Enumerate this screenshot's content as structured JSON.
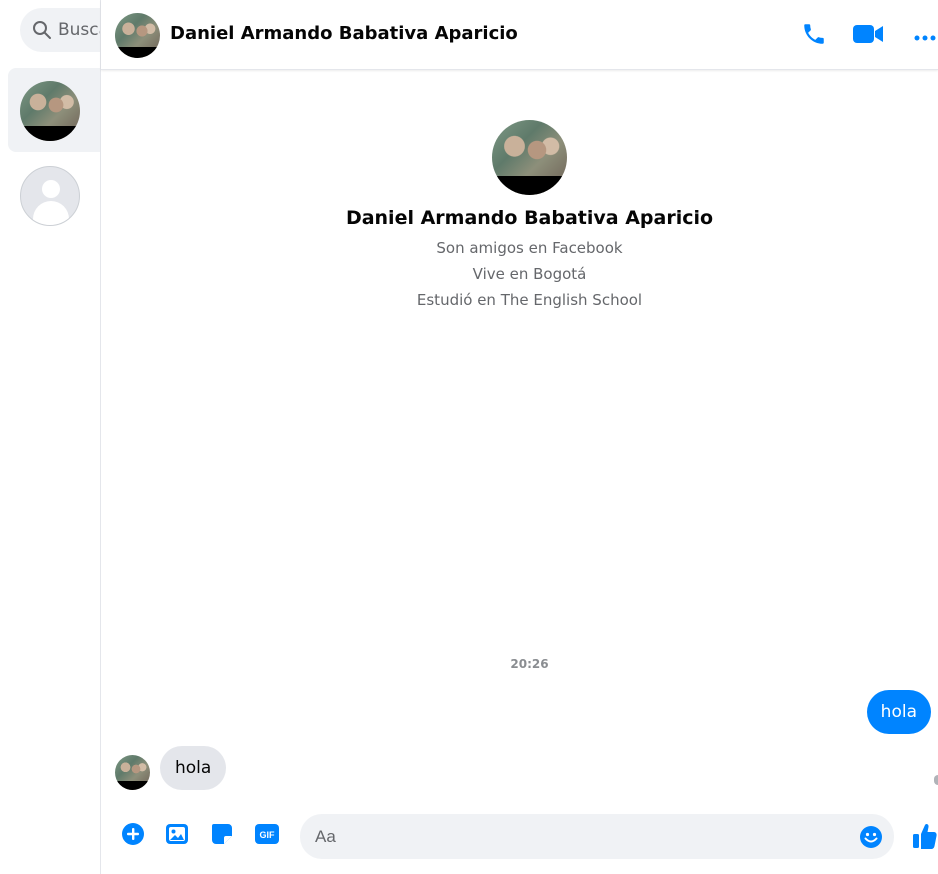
{
  "colors": {
    "accent": "#0084ff",
    "incoming_bubble": "#e4e6eb",
    "input_bg": "#f0f2f5",
    "muted_text": "#65676b"
  },
  "sidebar": {
    "search_placeholder": "Buscar en Messenger",
    "search_visible_text": "Busca",
    "conversations": [
      {
        "active": true,
        "avatar": "profile-photo"
      },
      {
        "active": false,
        "avatar": "default-avatar"
      }
    ]
  },
  "header": {
    "name": "Daniel Armando Babativa Aparicio",
    "actions": [
      "phone-icon",
      "video-camera-icon",
      "more-options-icon"
    ]
  },
  "profile": {
    "name": "Daniel Armando Babativa Aparicio",
    "lines": [
      "Son amigos en Facebook",
      "Vive en Bogotá",
      "Estudió en The English School"
    ]
  },
  "messages": {
    "timestamp": "20:26",
    "outgoing": [
      {
        "text": "hola"
      }
    ],
    "incoming": [
      {
        "text": "hola"
      }
    ]
  },
  "composer": {
    "placeholder": "Aa",
    "actions": [
      "plus-circle-icon",
      "photo-icon",
      "sticker-icon",
      "gif-icon"
    ],
    "emoji_icon": "smile-icon",
    "send_icon": "thumbs-up-icon"
  }
}
